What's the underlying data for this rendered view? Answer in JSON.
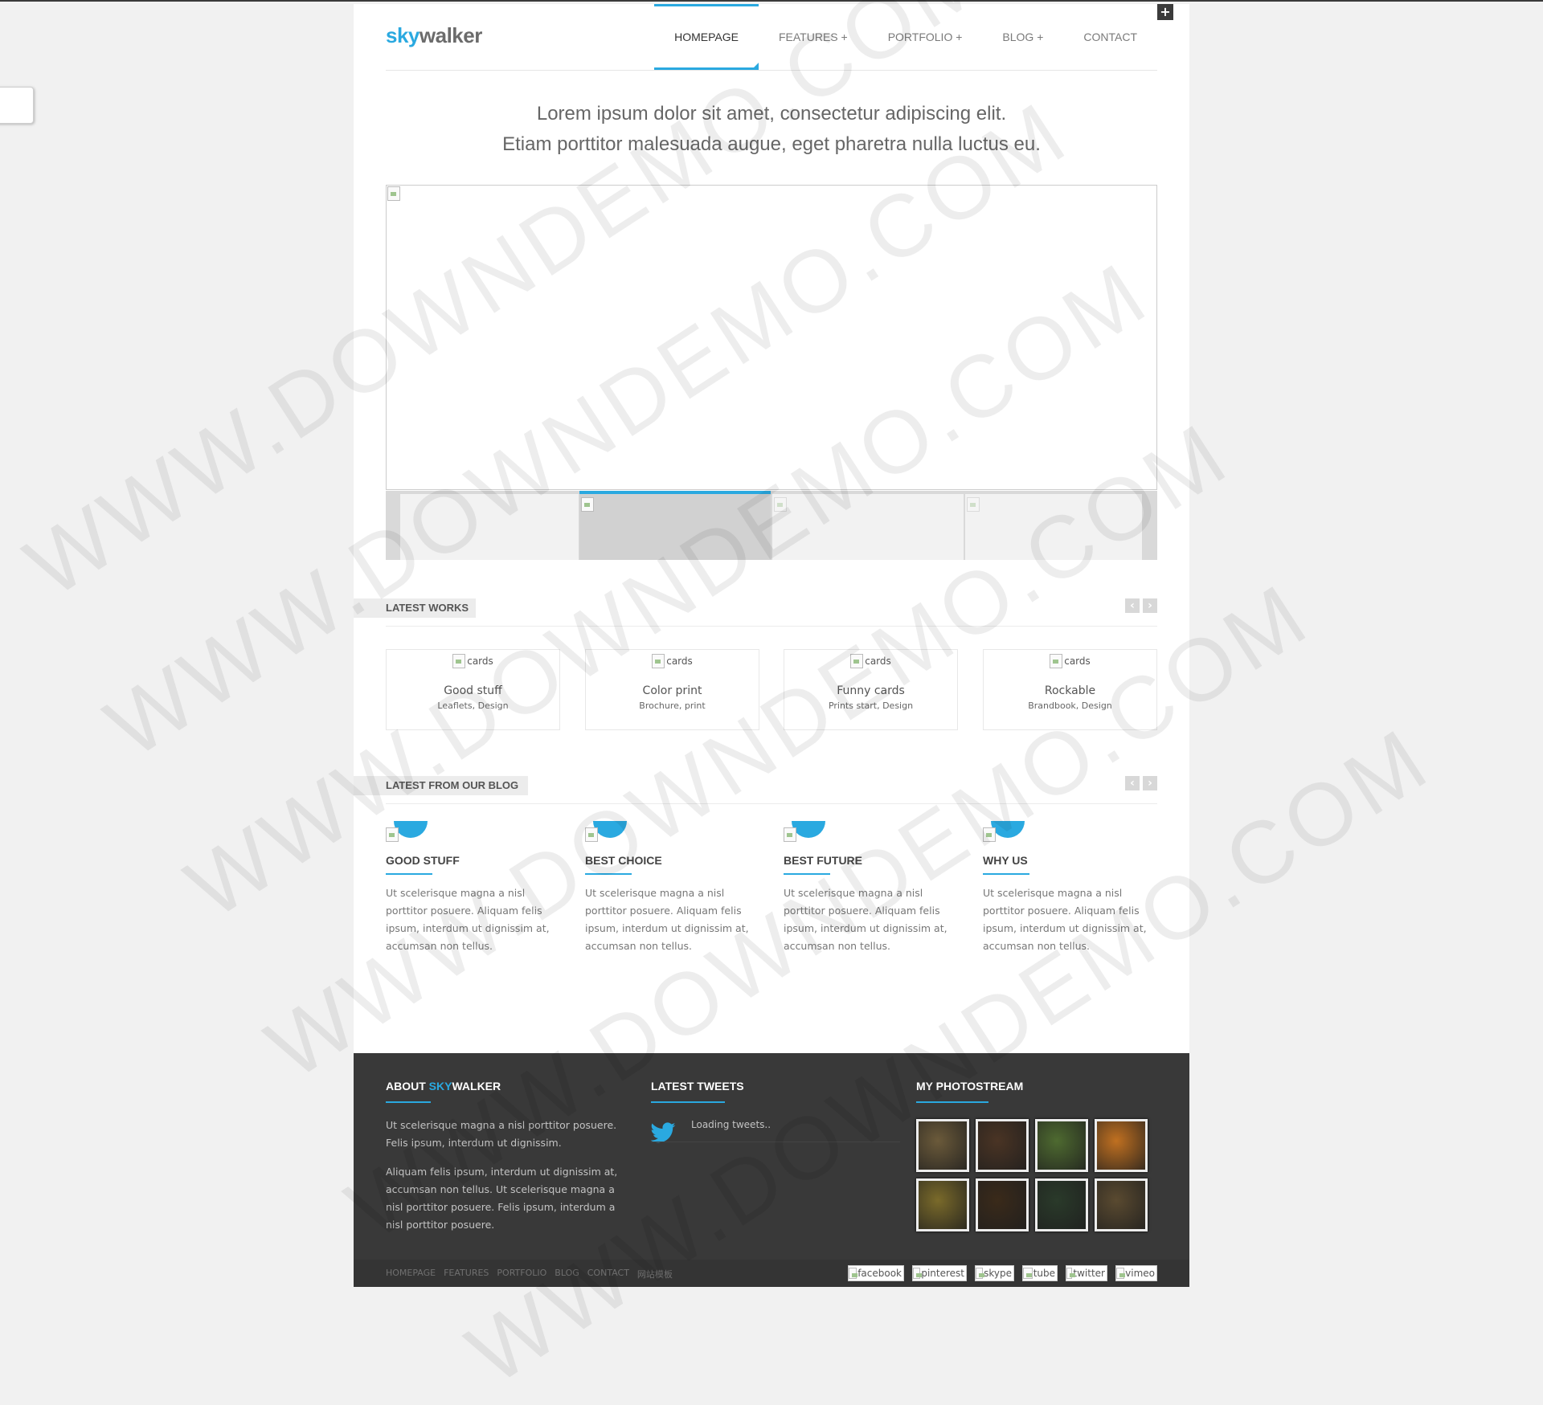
{
  "logo": {
    "part1": "sky",
    "part2": "walker"
  },
  "nav": {
    "items": [
      {
        "label": "HOMEPAGE",
        "active": true
      },
      {
        "label": "FEATURES +"
      },
      {
        "label": "PORTFOLIO +"
      },
      {
        "label": "BLOG +"
      },
      {
        "label": "CONTACT"
      }
    ]
  },
  "intro": {
    "line1": "Lorem ipsum dolor sit amet, consectetur adipiscing elit.",
    "line2": "Etiam porttitor malesuada augue, eget pharetra nulla luctus eu."
  },
  "latest_works": {
    "title": "LATEST WORKS",
    "prev": "‹",
    "next": "›",
    "cards": [
      {
        "img_alt": "cards",
        "title": "Good stuff",
        "sub": "Leaflets, Design"
      },
      {
        "img_alt": "cards",
        "title": "Color print",
        "sub": "Brochure, print"
      },
      {
        "img_alt": "cards",
        "title": "Funny cards",
        "sub": "Prints start, Design"
      },
      {
        "img_alt": "cards",
        "title": "Rockable",
        "sub": "Brandbook, Design"
      }
    ]
  },
  "blog": {
    "title": "LATEST FROM OUR BLOG",
    "prev": "‹",
    "next": "›",
    "posts": [
      {
        "title": "GOOD STUFF",
        "text": "Ut scelerisque magna a nisl porttitor posuere. Aliquam felis ipsum, interdum ut dignissim at, accumsan non tellus."
      },
      {
        "title": "BEST CHOICE",
        "text": "Ut scelerisque magna a nisl porttitor posuere. Aliquam felis ipsum, interdum ut dignissim at, accumsan non tellus."
      },
      {
        "title": "BEST FUTURE",
        "text": "Ut scelerisque magna a nisl porttitor posuere. Aliquam felis ipsum, interdum ut dignissim at, accumsan non tellus."
      },
      {
        "title": "WHY US",
        "text": "Ut scelerisque magna a nisl porttitor posuere. Aliquam felis ipsum, interdum ut dignissim at, accumsan non tellus."
      }
    ]
  },
  "footer": {
    "about": {
      "title_prefix": "ABOUT ",
      "title_accent": "SKY",
      "title_suffix": "WALKER",
      "p1": "Ut scelerisque magna a nisl porttitor posuere. Felis ipsum, interdum ut dignissim.",
      "p2": "Aliquam felis ipsum, interdum ut dignissim at, accumsan non tellus. Ut scelerisque magna a nisl porttitor posuere. Felis ipsum, interdum a nisl porttitor posuere."
    },
    "tweets": {
      "title": "LATEST TWEETS",
      "status": "Loading tweets.."
    },
    "photostream": {
      "title": "MY PHOTOSTREAM",
      "colors": [
        "#6b5a3a",
        "#4a3424",
        "#4e6a30",
        "#c07020",
        "#7a6a2a",
        "#3a2a1a",
        "#2a3a2a",
        "#5a4a30"
      ]
    },
    "nav": [
      "HOMEPAGE",
      "FEATURES",
      "PORTFOLIO",
      "BLOG",
      "CONTACT",
      "网站模板"
    ],
    "social": [
      "facebook",
      "pinterest",
      "skype",
      "tube",
      "twitter",
      "vimeo"
    ]
  },
  "watermark": "WWW.DOWNDEMO.COM",
  "colors": {
    "accent": "#2aa9e0",
    "footer_bg": "#393939",
    "page_bg": "#f1f1f1"
  }
}
